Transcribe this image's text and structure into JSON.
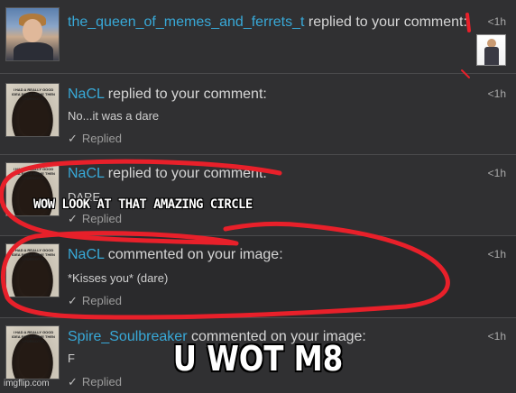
{
  "notifications": [
    {
      "user": "the_queen_of_memes_and_ferrets_t",
      "action": "replied to your comment:",
      "time": "<1h",
      "avatar": "rick-avatar",
      "has_thumbnail": true
    },
    {
      "user": "NaCL",
      "action": "replied to your comment:",
      "text": "No...it was a dare",
      "status": "Replied",
      "time": "<1h",
      "avatar": "nacl-avatar"
    },
    {
      "user": "NaCL",
      "action": "replied to your comment:",
      "text": "DARE",
      "status": "Replied",
      "time": "<1h",
      "avatar": "nacl-avatar"
    },
    {
      "user": "NaCL",
      "action": "commented on your image:",
      "text": "*Kisses you* (dare)",
      "status": "Replied",
      "time": "<1h",
      "avatar": "nacl-avatar"
    },
    {
      "user": "Spire_Soulbreaker",
      "action": "commented on your image:",
      "text": "F",
      "status": "Replied",
      "time": "<1h",
      "avatar": "nacl-avatar"
    }
  ],
  "avatar_caption": "I HAD A REALLY GOOD IDEA FOR A MEME THEN I FORGOT IT",
  "check_glyph": "✓",
  "meme": {
    "top_text": "WOW LOOK AT THAT AMAZING CIRCLE",
    "bottom_text": "U WOT M8",
    "watermark": "imgflip.com",
    "scribble_color": "#e8202a"
  },
  "colors": {
    "username": "#38a9d8",
    "background": "#2f2f31"
  }
}
